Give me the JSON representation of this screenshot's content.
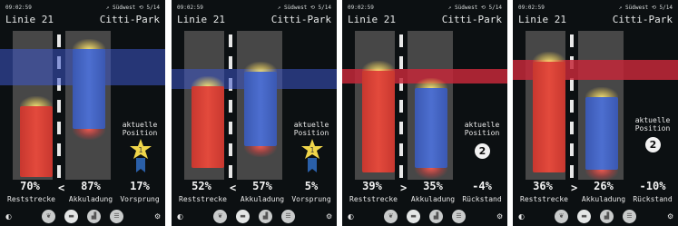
{
  "panels": [
    {
      "time": "09:02:59",
      "status_right": "↗ Südwest ⟲ 5/14",
      "line": "Linie 21",
      "stop": "Citti-Park",
      "band_color": "#3d56c8",
      "position_label_1": "aktuelle",
      "position_label_2": "Position",
      "position_number": "1",
      "left_value": "70%",
      "compare": "<",
      "mid_value": "87%",
      "right_value": "17%",
      "left_label": "Reststrecke",
      "mid_label": "Akkuladung",
      "right_label": "Vorsprung"
    },
    {
      "time": "09:02:59",
      "status_right": "↗ Südwest ⟲ 5/14",
      "line": "Linie 21",
      "stop": "Citti-Park",
      "band_color": "#3d56c8",
      "position_label_1": "aktuelle",
      "position_label_2": "Position",
      "position_number": "1",
      "left_value": "52%",
      "compare": "<",
      "mid_value": "57%",
      "right_value": "5%",
      "left_label": "Reststrecke",
      "mid_label": "Akkuladung",
      "right_label": "Vorsprung"
    },
    {
      "time": "09:02:59",
      "status_right": "↗ Südwest ⟲ 5/14",
      "line": "Linie 21",
      "stop": "Citti-Park",
      "band_color": "#c4283a",
      "position_label_1": "aktuelle",
      "position_label_2": "Position",
      "position_number": "2",
      "left_value": "39%",
      "compare": ">",
      "mid_value": "35%",
      "right_value": "-4%",
      "left_label": "Reststrecke",
      "mid_label": "Akkuladung",
      "right_label": "Rückstand"
    },
    {
      "time": "09:02:59",
      "status_right": "↗ Südwest ⟲ 5/14",
      "line": "Linie 21",
      "stop": "Citti-Park",
      "band_color": "#c4283a",
      "position_label_1": "aktuelle",
      "position_label_2": "Position",
      "position_number": "2",
      "left_value": "36%",
      "compare": ">",
      "mid_value": "26%",
      "right_value": "-10%",
      "left_label": "Reststrecke",
      "mid_label": "Akkuladung",
      "right_label": "Rückstand"
    }
  ],
  "nav_icons": [
    "contrast-icon",
    "leaf-icon",
    "bus-icon",
    "chart-icon",
    "list-icon",
    "settings-icon"
  ],
  "colors": {
    "background": "#0c1012",
    "road": "#474747",
    "lane_marking": "#e8e8e8",
    "bus_red": "#e34a3c",
    "bus_blue": "#4d6fd0",
    "star": "#f0d64a"
  }
}
